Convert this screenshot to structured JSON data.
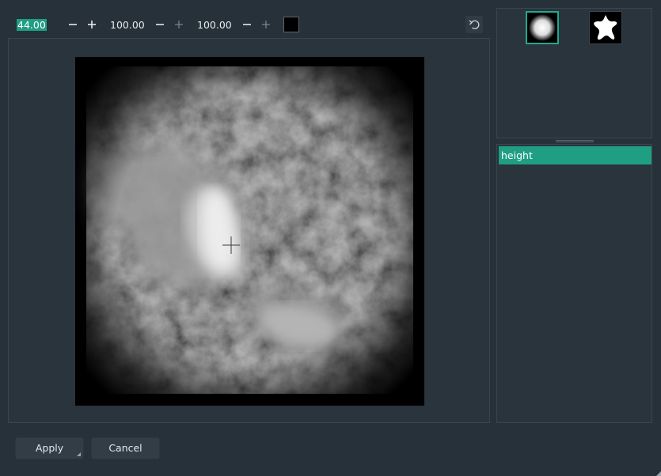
{
  "toolbar": {
    "size_value": "44.00",
    "opacity_value": "100.00",
    "flow_value": "100.00",
    "color": "#000000",
    "reset_icon": "undo-icon",
    "minus_icon": "minus-icon",
    "plus_icon": "plus-icon"
  },
  "brushes": [
    {
      "icon": "soft-circle-brush-icon",
      "selected": true
    },
    {
      "icon": "star-brush-icon",
      "selected": false
    }
  ],
  "layers": [
    {
      "label": "height",
      "selected": true
    }
  ],
  "buttons": {
    "apply_label": "Apply",
    "cancel_label": "Cancel"
  },
  "colors": {
    "accent": "#1f9e84",
    "background": "#27313a",
    "panel": "#2a343d"
  }
}
